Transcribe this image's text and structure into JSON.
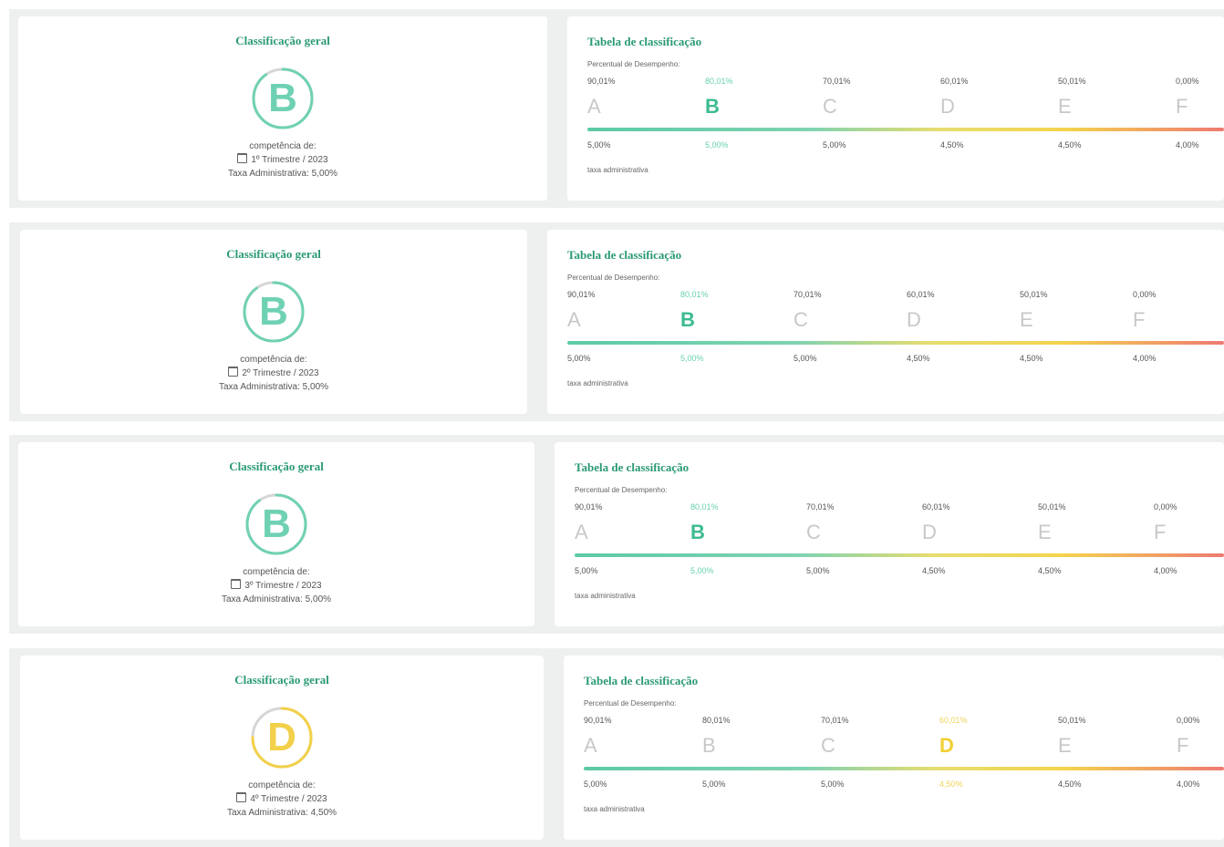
{
  "panels": [
    {
      "overall_title": "Classificação geral",
      "grade": "B",
      "grade_color": "#6fd1b3",
      "progress_fraction": 0.9,
      "competence_label": "competência de:",
      "period": "1º Trimestre / 2023",
      "admin_fee_text": "Taxa Administrativa: 5,00%",
      "table_title": "Tabela de classificação",
      "performance_label": "Percentual de Desempenho:",
      "admin_row_label": "taxa administrativa",
      "selected_index": 1
    },
    {
      "overall_title": "Classificação geral",
      "grade": "B",
      "grade_color": "#6fd1b3",
      "progress_fraction": 0.9,
      "competence_label": "competência de:",
      "period": "2º Trimestre / 2023",
      "admin_fee_text": "Taxa Administrativa: 5,00%",
      "table_title": "Tabela de classificação",
      "performance_label": "Percentual de Desempenho:",
      "admin_row_label": "taxa administrativa",
      "selected_index": 1
    },
    {
      "overall_title": "Classificação geral",
      "grade": "B",
      "grade_color": "#6fd1b3",
      "progress_fraction": 0.9,
      "competence_label": "competência de:",
      "period": "3º Trimestre / 2023",
      "admin_fee_text": "Taxa Administrativa: 5,00%",
      "table_title": "Tabela de classificação",
      "performance_label": "Percentual de Desempenho:",
      "admin_row_label": "taxa administrativa",
      "selected_index": 1
    },
    {
      "overall_title": "Classificação geral",
      "grade": "D",
      "grade_color": "#f2d04a",
      "progress_fraction": 0.75,
      "competence_label": "competência de:",
      "period": "4º Trimestre / 2023",
      "admin_fee_text": "Taxa Administrativa: 4,50%",
      "table_title": "Tabela de classificação",
      "performance_label": "Percentual de Desempenho:",
      "admin_row_label": "taxa administrativa",
      "selected_index": 3
    }
  ],
  "grades": [
    {
      "letter": "A",
      "threshold": "90,01%",
      "fee": "5,00%"
    },
    {
      "letter": "B",
      "threshold": "80,01%",
      "fee": "5,00%"
    },
    {
      "letter": "C",
      "threshold": "70,01%",
      "fee": "5,00%"
    },
    {
      "letter": "D",
      "threshold": "60,01%",
      "fee": "4,50%"
    },
    {
      "letter": "E",
      "threshold": "50,01%",
      "fee": "4,50%"
    },
    {
      "letter": "F",
      "threshold": "0,00%",
      "fee": "4,00%"
    }
  ],
  "colors": {
    "title_green": "#2b9a74",
    "selected_green": "#3dbb92",
    "selected_yellow": "#f2cf34",
    "inactive_letter": "#c8c8c8",
    "ring_track": "#d6d6d6"
  }
}
